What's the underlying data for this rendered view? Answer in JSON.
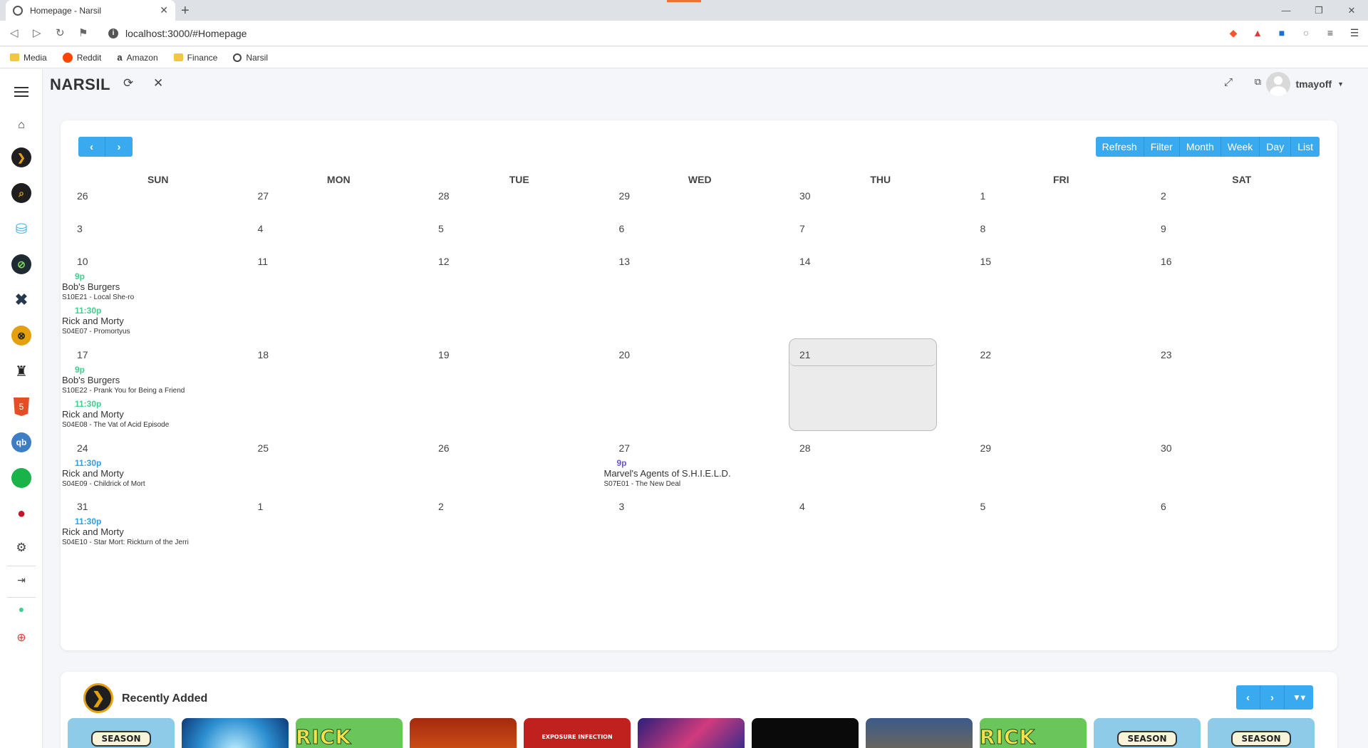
{
  "browser": {
    "tab_title": "Homepage - Narsil",
    "url": "localhost:3000/#Homepage",
    "bookmarks": [
      "Media",
      "Reddit",
      "Amazon",
      "Finance",
      "Narsil"
    ]
  },
  "app": {
    "brand": "NARSIL",
    "username": "tmayoff"
  },
  "sidebar": {
    "items": [
      "menu-icon",
      "home-icon",
      "plex-icon",
      "search-icon",
      "bucket-icon",
      "radarr-icon",
      "sonarr-icon",
      "ombi-icon",
      "jackett-icon",
      "html5-icon",
      "qbittorrent-icon",
      "green-icon",
      "pihole-icon",
      "gear-icon",
      "logout-icon",
      "github-icon",
      "lifebuoy-icon"
    ]
  },
  "calendar": {
    "view_buttons": [
      "Refresh",
      "Filter",
      "Month",
      "Week",
      "Day",
      "List"
    ],
    "days_of_week": [
      "SUN",
      "MON",
      "TUE",
      "WED",
      "THU",
      "FRI",
      "SAT"
    ],
    "weeks": [
      {
        "days": [
          "26",
          "27",
          "28",
          "29",
          "30",
          "1",
          "2"
        ],
        "events": []
      },
      {
        "days": [
          "3",
          "4",
          "5",
          "6",
          "7",
          "8",
          "9"
        ],
        "events": []
      },
      {
        "days": [
          "10",
          "11",
          "12",
          "13",
          "14",
          "15",
          "16"
        ],
        "events": [
          {
            "day": 0,
            "time": "9p",
            "title": "Bob's Burgers",
            "subtitle": "S10E21 - Local She-ro",
            "color": "#3ecf8e"
          },
          {
            "day": 0,
            "time": "11:30p",
            "title": "Rick and Morty",
            "subtitle": "S04E07 - Promortyus",
            "color": "#3ecf8e"
          }
        ]
      },
      {
        "days": [
          "17",
          "18",
          "19",
          "20",
          "21",
          "22",
          "23"
        ],
        "events": [
          {
            "day": 0,
            "time": "9p",
            "title": "Bob's Burgers",
            "subtitle": "S10E22 - Prank You for Being a Friend",
            "color": "#3ecf8e"
          },
          {
            "day": 0,
            "time": "11:30p",
            "title": "Rick and Morty",
            "subtitle": "S04E08 - The Vat of Acid Episode",
            "color": "#3ecf8e"
          }
        ]
      },
      {
        "days": [
          "24",
          "25",
          "26",
          "27",
          "28",
          "29",
          "30"
        ],
        "events": [
          {
            "day": 0,
            "time": "11:30p",
            "title": "Rick and Morty",
            "subtitle": "S04E09 - Childrick of Mort",
            "color": "#2c9fe0"
          },
          {
            "day": 3,
            "time": "9p",
            "title": "Marvel's Agents of S.H.I.E.L.D.",
            "subtitle": "S07E01 - The New Deal",
            "color": "#6a55d8"
          }
        ]
      },
      {
        "days": [
          "31",
          "1",
          "2",
          "3",
          "4",
          "5",
          "6"
        ],
        "events": [
          {
            "day": 0,
            "time": "11:30p",
            "title": "Rick and Morty",
            "subtitle": "S04E10 - Star Mort: Rickturn of the Jerri",
            "color": "#2c9fe0"
          }
        ]
      }
    ],
    "today": "21"
  },
  "recently_added": {
    "title": "Recently Added",
    "posters": [
      {
        "style": "season",
        "label": "SEASON"
      },
      {
        "style": "blue",
        "label": ""
      },
      {
        "style": "rick",
        "label": "RICK AND"
      },
      {
        "style": "fire",
        "label": ""
      },
      {
        "style": "red",
        "label": "EXPOSURE INFECTION"
      },
      {
        "style": "cosmic",
        "label": ""
      },
      {
        "style": "black",
        "label": ""
      },
      {
        "style": "land",
        "label": ""
      },
      {
        "style": "rick",
        "label": "RICK AND"
      },
      {
        "style": "season",
        "label": "SEASON"
      },
      {
        "style": "season",
        "label": "SEASON"
      }
    ]
  }
}
